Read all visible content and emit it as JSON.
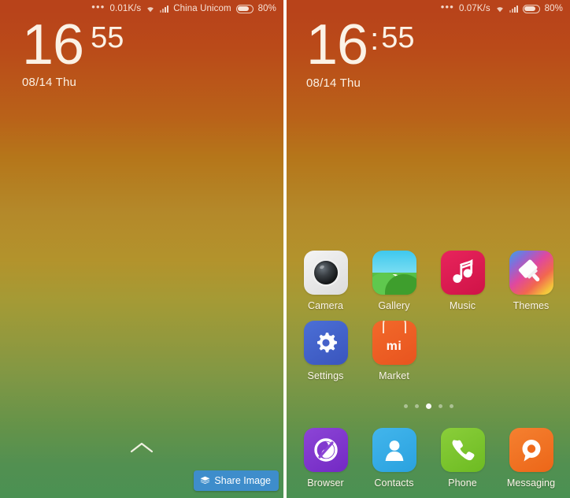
{
  "left_screen": {
    "type": "lockscreen",
    "statusbar": {
      "dots_icon": "overflow-dots-icon",
      "network_speed": "0.01K/s",
      "wifi_icon": "wifi-icon",
      "signal_icon": "signal-bars-icon",
      "carrier": "China Unicom",
      "battery_icon": "battery-icon",
      "battery_percent": "80%"
    },
    "clock": {
      "hours": "16",
      "separator": "",
      "minutes": "55",
      "date": "08/14 Thu"
    },
    "unlock_icon": "chevron-up-icon",
    "share_button": {
      "label": "Share Image",
      "icon": "layers-stack-icon"
    }
  },
  "right_screen": {
    "type": "homescreen",
    "statusbar": {
      "dots_icon": "overflow-dots-icon",
      "network_speed": "0.07K/s",
      "wifi_icon": "wifi-icon",
      "signal_icon": "signal-bars-icon",
      "carrier": "",
      "battery_icon": "battery-icon",
      "battery_percent": "80%"
    },
    "clock": {
      "hours": "16",
      "separator": ":",
      "minutes": "55",
      "date": "08/14  Thu"
    },
    "apps": [
      {
        "label": "Camera",
        "icon": "camera-icon"
      },
      {
        "label": "Gallery",
        "icon": "gallery-icon"
      },
      {
        "label": "Music",
        "icon": "music-note-icon"
      },
      {
        "label": "Themes",
        "icon": "paint-brush-icon"
      },
      {
        "label": "Settings",
        "icon": "gear-icon"
      },
      {
        "label": "Market",
        "icon": "mi-market-icon"
      }
    ],
    "market_wordmark": "mi",
    "page_indicator": {
      "total": 5,
      "active": 3
    },
    "dock": [
      {
        "label": "Browser",
        "icon": "browser-spiral-icon"
      },
      {
        "label": "Contacts",
        "icon": "person-icon"
      },
      {
        "label": "Phone",
        "icon": "phone-handset-icon"
      },
      {
        "label": "Messaging",
        "icon": "speech-bubble-icon"
      }
    ]
  },
  "colors": {
    "gradient_top": "#b8431a",
    "gradient_mid": "#b3932c",
    "gradient_bottom": "#4a9152",
    "share_button_bg": "#3e8dcb",
    "label_text": "#fdf6ea"
  }
}
